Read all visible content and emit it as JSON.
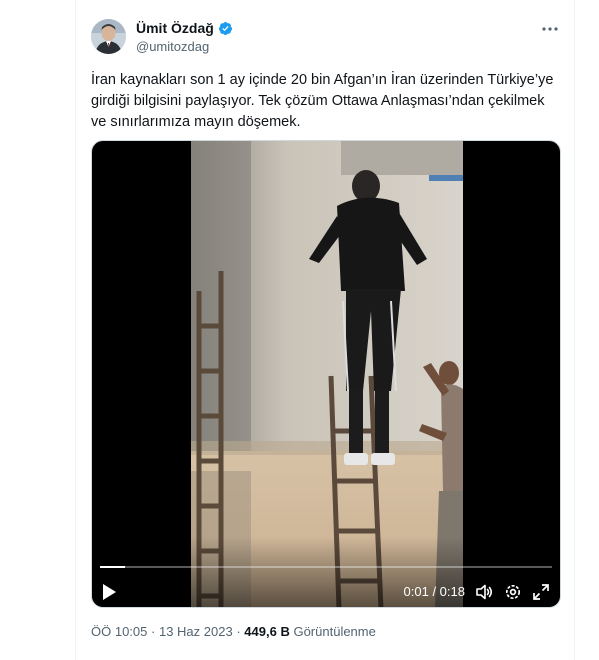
{
  "author": {
    "display_name": "Ümit Özdağ",
    "handle": "@umitozdag",
    "verified": true
  },
  "tweet": {
    "text_lines": [
      "İran kaynakları son 1 ay içinde 20 bin Afgan’ın İran üzerinden Türkiye’ye",
      "girdiği bilgisini paylaşıyor. Tek çözüm Ottawa Anlaşması’ndan çekilmek",
      "ve sınırlarımıza mayın döşemek."
    ]
  },
  "video": {
    "time_display": "0:01 / 0:18",
    "progress_fraction": 0.055
  },
  "meta": {
    "time": "ÖÖ 10:05",
    "separator": "·",
    "date": "13 Haz 2023",
    "views_count": "449,6 B",
    "views_label": "Görüntülenme"
  },
  "icons": {
    "verified": "verified-badge-icon",
    "more": "more-options-icon",
    "play": "play-icon",
    "volume": "volume-icon",
    "settings": "settings-icon",
    "fullscreen": "fullscreen-icon"
  },
  "colors": {
    "verified_blue": "#1d9bf0",
    "text_primary": "#0f1419",
    "text_secondary": "#536471",
    "video_bg": "#000000"
  }
}
